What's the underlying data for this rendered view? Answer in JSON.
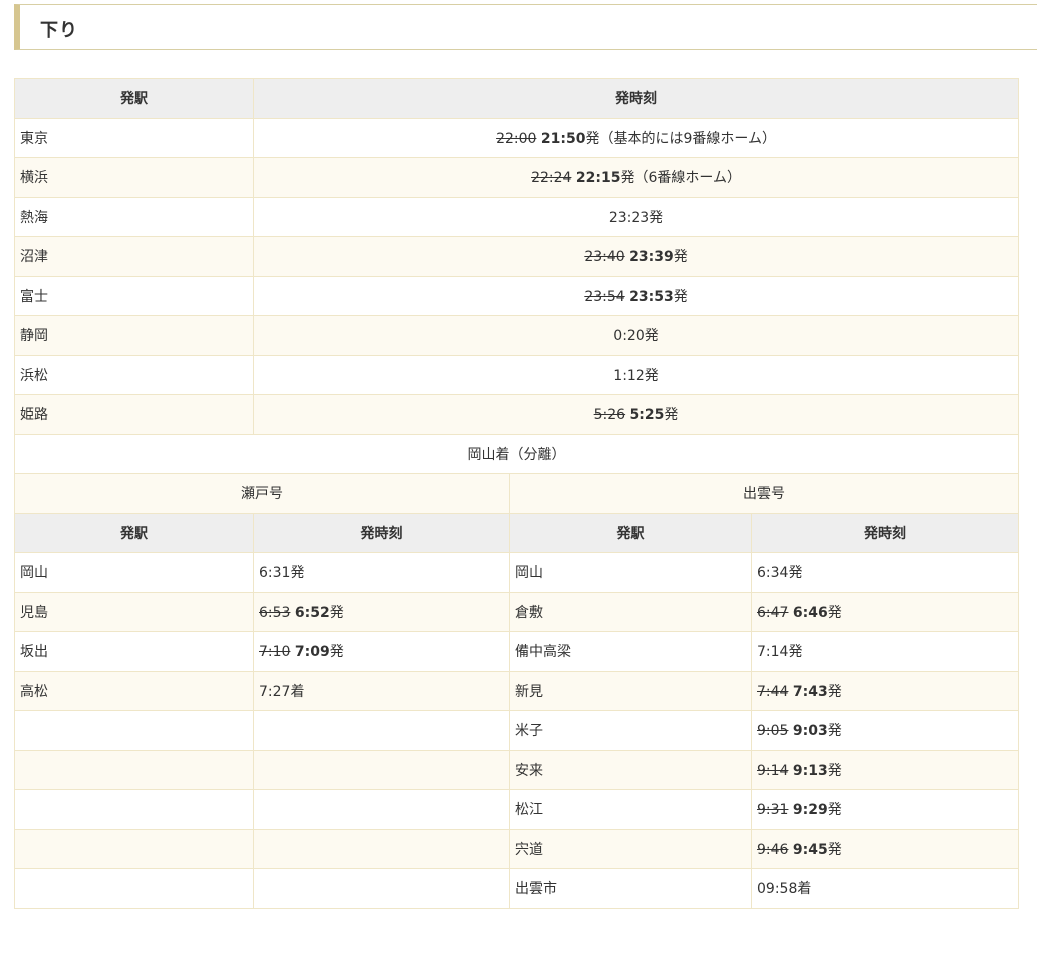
{
  "section": {
    "title": "下り"
  },
  "main_table": {
    "headers": [
      "発駅",
      "発時刻"
    ],
    "rows": [
      {
        "station": "東京",
        "old_time": "22:00",
        "new_time": "21:50",
        "suffix": "発（基本的には9番線ホーム）",
        "plain": ""
      },
      {
        "station": "横浜",
        "old_time": "22:24",
        "new_time": "22:15",
        "suffix": "発（6番線ホーム）",
        "plain": ""
      },
      {
        "station": "熱海",
        "old_time": "",
        "new_time": "",
        "suffix": "",
        "plain": "23:23発"
      },
      {
        "station": "沼津",
        "old_time": "23:40",
        "new_time": "23:39",
        "suffix": "発",
        "plain": ""
      },
      {
        "station": "富士",
        "old_time": "23:54",
        "new_time": "23:53",
        "suffix": "発",
        "plain": ""
      },
      {
        "station": "静岡",
        "old_time": "",
        "new_time": "",
        "suffix": "",
        "plain": "0:20発"
      },
      {
        "station": "浜松",
        "old_time": "",
        "new_time": "",
        "suffix": "",
        "plain": "1:12発"
      },
      {
        "station": "姫路",
        "old_time": "5:26",
        "new_time": "5:25",
        "suffix": "発",
        "plain": ""
      }
    ],
    "split_note": "岡山着（分離）"
  },
  "split_table": {
    "seto_name": "瀬戸号",
    "izumo_name": "出雲号",
    "headers": [
      "発駅",
      "発時刻",
      "発駅",
      "発時刻"
    ],
    "rows": [
      {
        "s1": "岡山",
        "o1": "",
        "n1": "",
        "x1": "",
        "p1": "6:31発",
        "s2": "岡山",
        "o2": "",
        "n2": "",
        "x2": "",
        "p2": "6:34発"
      },
      {
        "s1": "児島",
        "o1": "6:53",
        "n1": "6:52",
        "x1": "発",
        "p1": "",
        "s2": "倉敷",
        "o2": "6:47",
        "n2": "6:46",
        "x2": "発",
        "p2": ""
      },
      {
        "s1": "坂出",
        "o1": "7:10",
        "n1": "7:09",
        "x1": "発",
        "p1": "",
        "s2": "備中高梁",
        "o2": "",
        "n2": "",
        "x2": "",
        "p2": "7:14発"
      },
      {
        "s1": "高松",
        "o1": "",
        "n1": "",
        "x1": "",
        "p1": "7:27着",
        "s2": "新見",
        "o2": "7:44",
        "n2": "7:43",
        "x2": "発",
        "p2": ""
      },
      {
        "s1": "",
        "o1": "",
        "n1": "",
        "x1": "",
        "p1": "",
        "s2": "米子",
        "o2": "9:05",
        "n2": "9:03",
        "x2": "発",
        "p2": ""
      },
      {
        "s1": "",
        "o1": "",
        "n1": "",
        "x1": "",
        "p1": "",
        "s2": "安来",
        "o2": "9:14",
        "n2": "9:13",
        "x2": "発",
        "p2": ""
      },
      {
        "s1": "",
        "o1": "",
        "n1": "",
        "x1": "",
        "p1": "",
        "s2": "松江",
        "o2": "9:31",
        "n2": "9:29",
        "x2": "発",
        "p2": ""
      },
      {
        "s1": "",
        "o1": "",
        "n1": "",
        "x1": "",
        "p1": "",
        "s2": "宍道",
        "o2": "9:46",
        "n2": "9:45",
        "x2": "発",
        "p2": ""
      },
      {
        "s1": "",
        "o1": "",
        "n1": "",
        "x1": "",
        "p1": "",
        "s2": "出雲市",
        "o2": "",
        "n2": "",
        "x2": "",
        "p2": "09:58着"
      }
    ]
  },
  "colors": {
    "heading_accent": "#d6c690",
    "heading_border": "#d8cfa4",
    "header_bg": "#eeeeee",
    "row_alt_bg": "#fdfaf1",
    "cell_border": "#efe6c8"
  }
}
